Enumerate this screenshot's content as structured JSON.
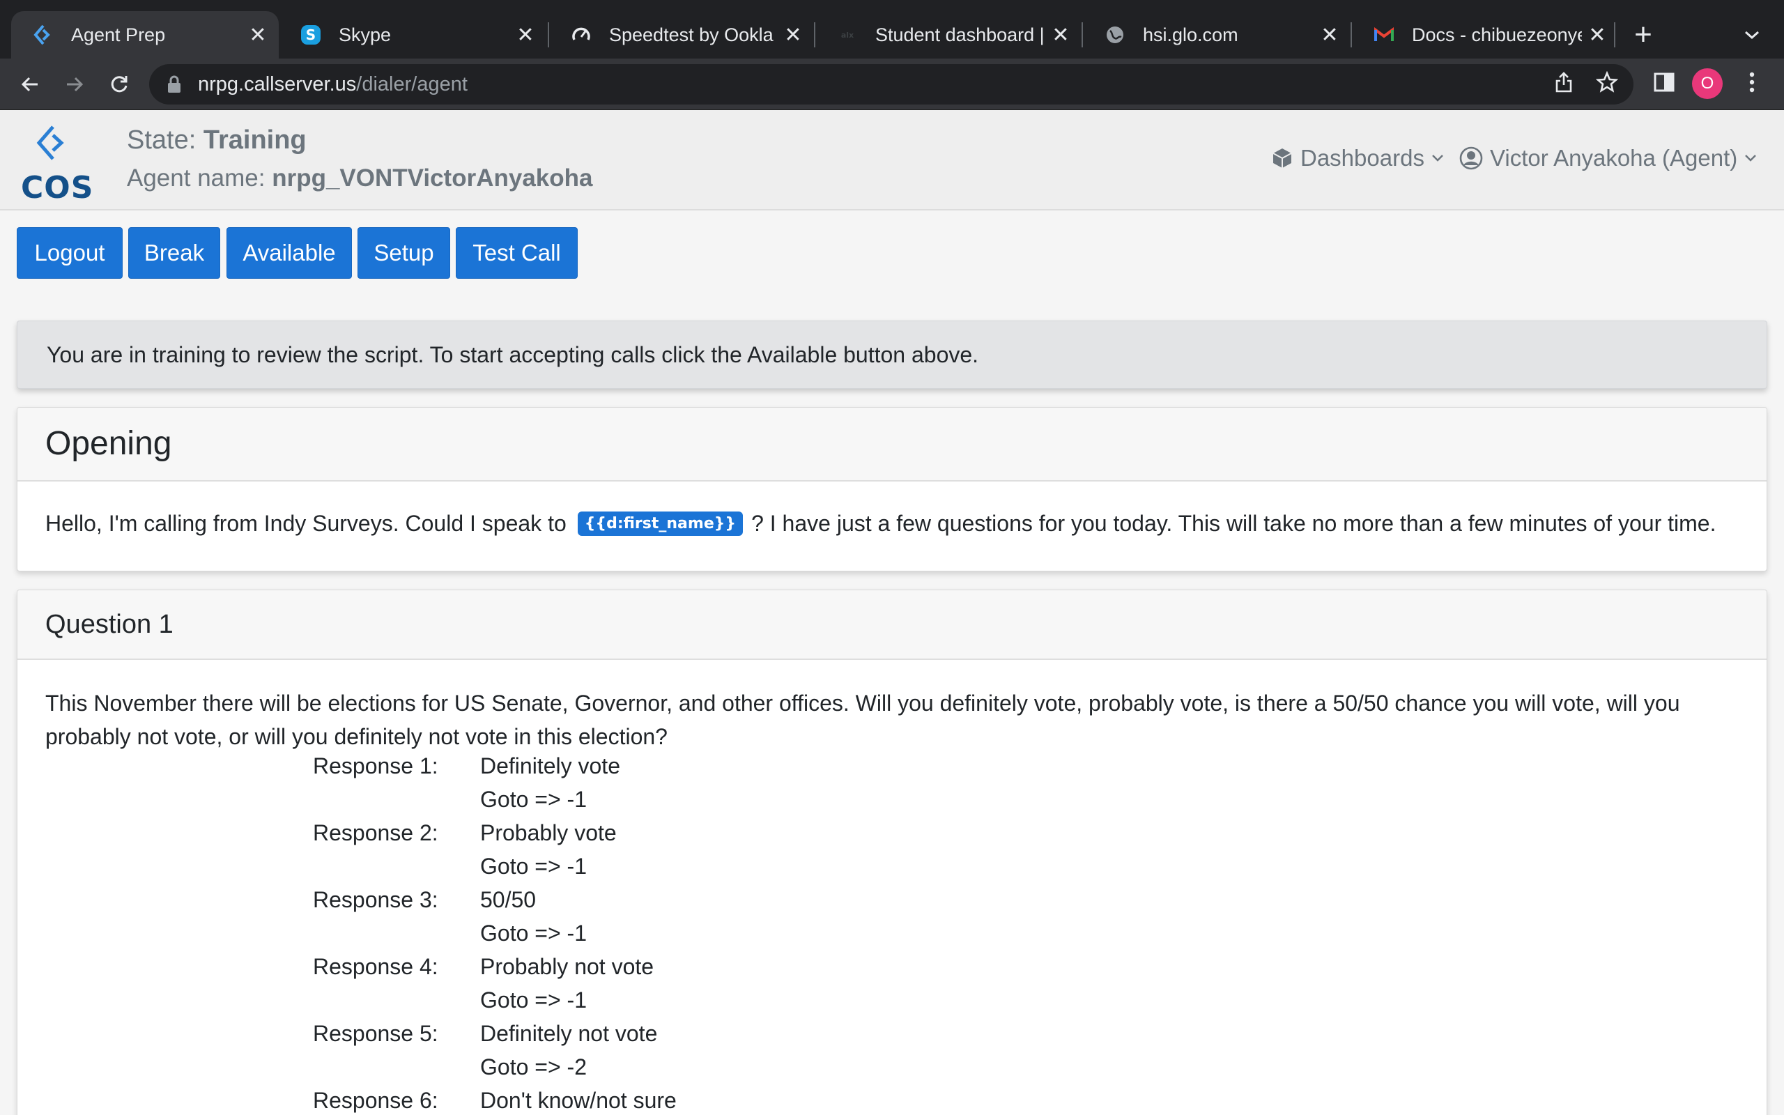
{
  "browser": {
    "tabs": [
      {
        "title": "Agent Prep",
        "icon": "app-logo-icon",
        "active": true
      },
      {
        "title": "Skype",
        "icon": "skype-icon",
        "active": false
      },
      {
        "title": "Speedtest by Ookla - T",
        "icon": "speedtest-icon",
        "active": false
      },
      {
        "title": "Student dashboard | L",
        "icon": "site-icon",
        "active": false
      },
      {
        "title": "hsi.glo.com",
        "icon": "globe-icon",
        "active": false
      },
      {
        "title": "Docs - chibuezeonyen",
        "icon": "gmail-icon",
        "active": false
      }
    ],
    "url_host": "nrpg.callserver.us",
    "url_path": "/dialer/agent",
    "profile_initial": "O",
    "colors": {
      "profile": "#e9387a",
      "chrome_dark": "#202124",
      "chrome_tab": "#35363a"
    }
  },
  "header": {
    "logo_text": "COS",
    "state_label": "State:",
    "state_value": "Training",
    "agent_label": "Agent name:",
    "agent_value": "nrpg_VONTVictorAnyakoha",
    "dashboards_label": "Dashboards",
    "user_label": "Victor Anyakoha (Agent)"
  },
  "actions": {
    "logout": "Logout",
    "break": "Break",
    "available": "Available",
    "setup": "Setup",
    "test_call": "Test Call",
    "accent_color": "#1b74d6"
  },
  "alert": {
    "message": "You are in training to review the script. To start accepting calls click the Available button above."
  },
  "opening": {
    "title": "Opening",
    "text_before": "Hello, I'm calling from Indy Surveys. Could I speak to",
    "token": "{{d:first_name}}",
    "text_after": "? I have just a few questions for you today. This will take no more than a few minutes of your time."
  },
  "question1": {
    "title": "Question 1",
    "text": "This November there will be elections for US Senate, Governor, and other offices. Will you definitely vote, probably vote, is there a 50/50 chance you will vote, will you probably not vote, or will you definitely not vote in this election?",
    "responses": [
      {
        "label": "Response 1:",
        "answer": "Definitely vote",
        "goto": "Goto => -1"
      },
      {
        "label": "Response 2:",
        "answer": "Probably vote",
        "goto": "Goto => -1"
      },
      {
        "label": "Response 3:",
        "answer": "50/50",
        "goto": "Goto => -1"
      },
      {
        "label": "Response 4:",
        "answer": "Probably not vote",
        "goto": "Goto => -1"
      },
      {
        "label": "Response 5:",
        "answer": "Definitely not vote",
        "goto": "Goto => -2"
      },
      {
        "label": "Response 6:",
        "answer": "Don't know/not sure",
        "goto": ""
      }
    ]
  }
}
